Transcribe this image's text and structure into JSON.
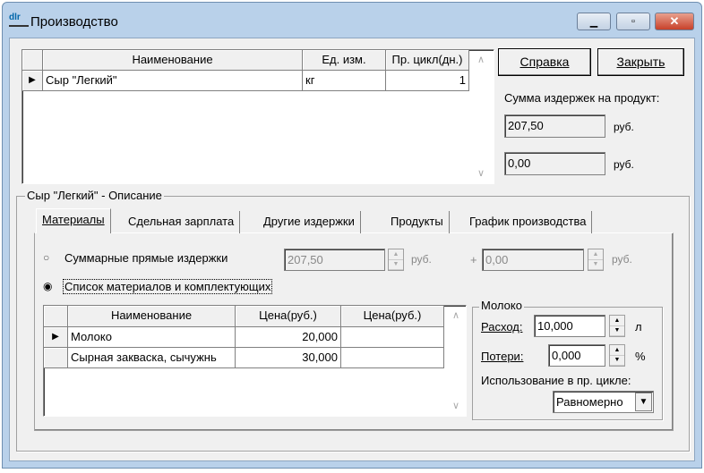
{
  "window": {
    "title": "Производство",
    "icon": "app-icon"
  },
  "products_table": {
    "columns": [
      "Наименование",
      "Ед. изм.",
      "Пр. цикл(дн.)"
    ],
    "rows": [
      {
        "name": "Сыр \"Легкий\"",
        "unit": "кг",
        "cycle": "1"
      }
    ]
  },
  "buttons": {
    "help": "Справка",
    "close": "Закрыть"
  },
  "cost_sum": {
    "label": "Сумма издержек на продукт:",
    "value1": "207,50",
    "value2": "0,00",
    "currency": "руб."
  },
  "description_group": {
    "title": "Сыр \"Легкий\" - Описание"
  },
  "tabs": [
    "Материалы",
    "Сдельная зарплата",
    "Другие издержки",
    "Продукты",
    "График производства"
  ],
  "materials": {
    "radio_total": "Суммарные прямые издержки",
    "total_value": "207,50",
    "currency": "руб.",
    "plus": "+",
    "extra_value": "0,00",
    "radio_list": "Список материалов и комплектующих",
    "columns": [
      "Наименование",
      "Цена(руб.)",
      "Цена(руб.)"
    ],
    "rows": [
      {
        "name": "Молоко",
        "price": "20,000",
        "price2": ""
      },
      {
        "name": "Сырная закваска, сычужнь",
        "price": "30,000",
        "price2": ""
      }
    ]
  },
  "detail": {
    "title": "Молоко",
    "consumption_label": "Расход:",
    "consumption": "10,000",
    "consumption_unit": "л",
    "loss_label": "Потери:",
    "loss": "0,000",
    "loss_unit": "%",
    "usage_label": "Использование в пр. цикле:",
    "usage": "Равномерно"
  }
}
